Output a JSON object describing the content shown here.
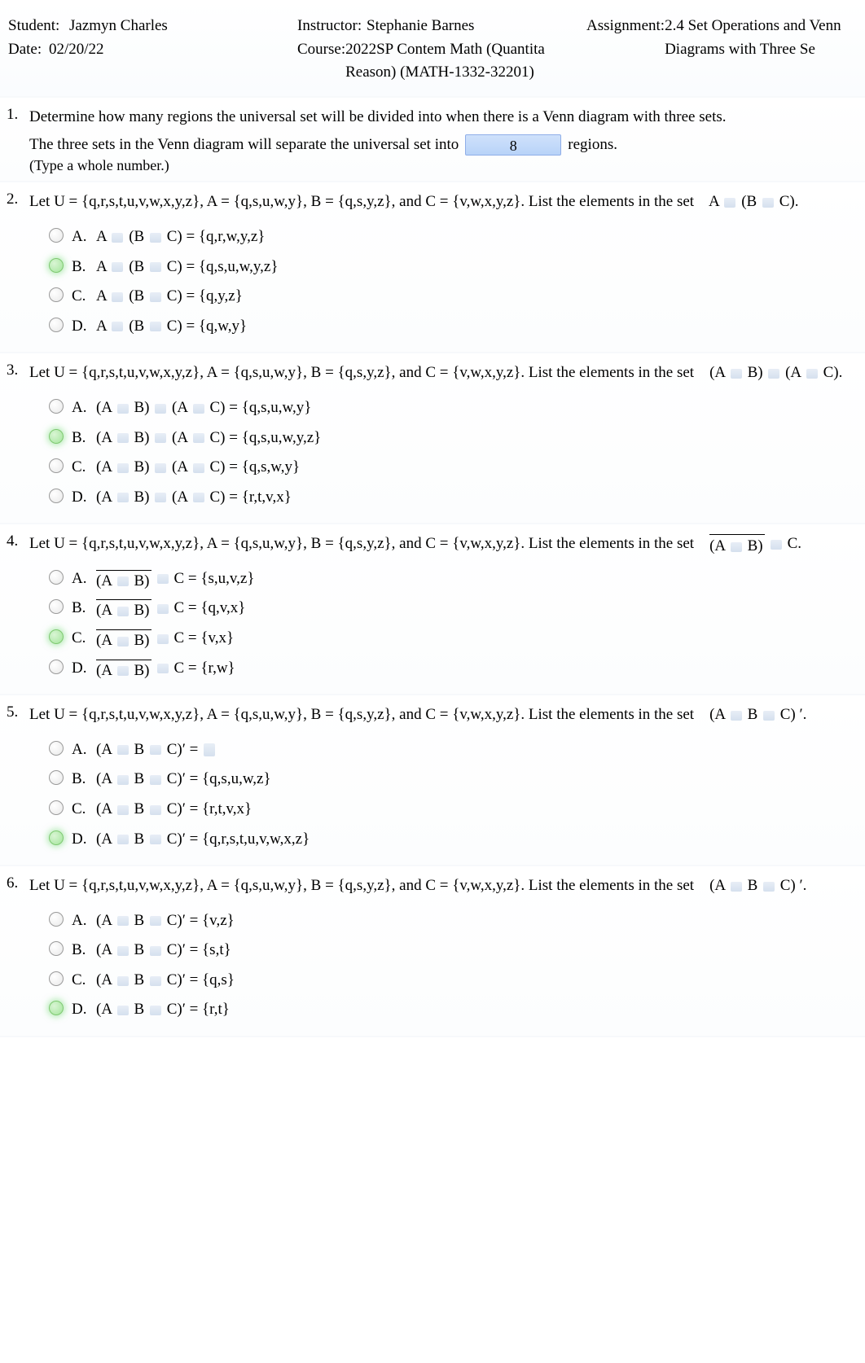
{
  "header": {
    "student_label": "Student:",
    "student": "Jazmyn Charles",
    "date_label": "Date:",
    "date": "02/20/22",
    "instructor_label": "Instructor:",
    "instructor": "Stephanie Barnes",
    "course_label": "Course:",
    "course": "2022SP Contem Math (Quantita Reason) (MATH-1332-32201)",
    "assignment_label": "Assignment:",
    "assignment": "2.4 Set Operations and Venn Diagrams with Three Se"
  },
  "q1": {
    "num": "1.",
    "prompt": "Determine how many regions the universal set will be divided into when there is a Venn diagram with three sets.",
    "line_before": "The three sets in the Venn diagram will separate the universal set into",
    "answer": "8",
    "line_after": "regions.",
    "hint": "(Type a whole number.)"
  },
  "q2": {
    "num": "2.",
    "prompt_part1": "Let U",
    "setU": "= {q,r,s,t,u,v,w,x,y,z}, A",
    "setA": "= {q,s,u,w,y}, B",
    "setB": "= {q,s,y,z}, and C",
    "setC": "= {v,w,x,y,z}. List the elements in the set",
    "tail1": "A",
    "tail2": "(B",
    "tail3": "C).",
    "choices": [
      {
        "letter": "A.",
        "expr_lhs": "A",
        "expr_mid": "(B",
        "expr_end": "C) =",
        "rhs": "{q,r,w,y,z}",
        "correct": false
      },
      {
        "letter": "B.",
        "expr_lhs": "A",
        "expr_mid": "(B",
        "expr_end": "C) =",
        "rhs": "{q,s,u,w,y,z}",
        "correct": true
      },
      {
        "letter": "C.",
        "expr_lhs": "A",
        "expr_mid": "(B",
        "expr_end": "C) =",
        "rhs": "{q,y,z}",
        "correct": false
      },
      {
        "letter": "D.",
        "expr_lhs": "A",
        "expr_mid": "(B",
        "expr_end": "C) =",
        "rhs": "{q,w,y}",
        "correct": false
      }
    ]
  },
  "q3": {
    "num": "3.",
    "prompt_part1": "Let U",
    "setU": "= {q,r,s,t,u,v,w,x,y,z}, A",
    "setA": "= {q,s,u,w,y}, B",
    "setB": "= {q,s,y,z}, and C",
    "setC": "= {v,w,x,y,z}. List the elements in the set",
    "tail_ab": "(A",
    "tail_b": "B)",
    "tail_ac": "(A",
    "tail_c": "C).",
    "choices": [
      {
        "letter": "A.",
        "l1": "(A",
        "l2": "B)",
        "l3": "(A",
        "l4": "C) =",
        "rhs": "{q,s,u,w,y}",
        "correct": false
      },
      {
        "letter": "B.",
        "l1": "(A",
        "l2": "B)",
        "l3": "(A",
        "l4": "C) =",
        "rhs": "{q,s,u,w,y,z}",
        "correct": true
      },
      {
        "letter": "C.",
        "l1": "(A",
        "l2": "B)",
        "l3": "(A",
        "l4": "C) =",
        "rhs": "{q,s,w,y}",
        "correct": false
      },
      {
        "letter": "D.",
        "l1": "(A",
        "l2": "B)",
        "l3": "(A",
        "l4": "C) =",
        "rhs": "{r,t,v,x}",
        "correct": false
      }
    ]
  },
  "q4": {
    "num": "4.",
    "prompt_part1": "Let U",
    "setU": "= {q,r,s,t,u,v,w,x,y,z}, A",
    "setA": "= {q,s,u,w,y}, B",
    "setB": "= {q,s,y,z}, and C",
    "setC": "= {v,w,x,y,z}. List the elements in the set",
    "tail_ab": "(A",
    "tail_b": "B)",
    "tail_c": "C.",
    "choices": [
      {
        "letter": "A.",
        "l1": "(A",
        "l2": "B)",
        "l3": "C =",
        "rhs": "{s,u,v,z}",
        "correct": false
      },
      {
        "letter": "B.",
        "l1": "(A",
        "l2": "B)",
        "l3": "C =",
        "rhs": "{q,v,x}",
        "correct": false
      },
      {
        "letter": "C.",
        "l1": "(A",
        "l2": "B)",
        "l3": "C =",
        "rhs": "{v,x}",
        "correct": true
      },
      {
        "letter": "D.",
        "l1": "(A",
        "l2": "B)",
        "l3": "C =",
        "rhs": "{r,w}",
        "correct": false
      }
    ]
  },
  "q5": {
    "num": "5.",
    "prompt_part1": "Let U",
    "setU": "= {q,r,s,t,u,v,w,x,y,z}, A",
    "setA": "= {q,s,u,w,y}, B",
    "setB": "= {q,s,y,z}, and C",
    "setC": "= {v,w,x,y,z}. List the elements in the set",
    "tail_a": "(A",
    "tail_b": "B",
    "tail_c": "C)",
    "prime": "′.",
    "choices": [
      {
        "letter": "A.",
        "l1": "(A",
        "l2": "B",
        "l3": "C)",
        "prime": "′ =",
        "rhs": "",
        "correct": false,
        "empty": true
      },
      {
        "letter": "B.",
        "l1": "(A",
        "l2": "B",
        "l3": "C)",
        "prime": "′ =",
        "rhs": "{q,s,u,w,z}",
        "correct": false
      },
      {
        "letter": "C.",
        "l1": "(A",
        "l2": "B",
        "l3": "C)",
        "prime": "′ =",
        "rhs": "{r,t,v,x}",
        "correct": false
      },
      {
        "letter": "D.",
        "l1": "(A",
        "l2": "B",
        "l3": "C)",
        "prime": "′ =",
        "rhs": "{q,r,s,t,u,v,w,x,z}",
        "correct": true
      }
    ]
  },
  "q6": {
    "num": "6.",
    "prompt_part1": "Let U",
    "setU": "= {q,r,s,t,u,v,w,x,y,z}, A",
    "setA": "= {q,s,u,w,y}, B",
    "setB": "= {q,s,y,z}, and C",
    "setC": "= {v,w,x,y,z}. List the elements in the set",
    "tail_a": "(A",
    "tail_b": "B",
    "tail_c": "C)",
    "prime": "′.",
    "choices": [
      {
        "letter": "A.",
        "l1": "(A",
        "l2": "B",
        "l3": "C)",
        "prime": "′ =",
        "rhs": "{v,z}",
        "correct": false
      },
      {
        "letter": "B.",
        "l1": "(A",
        "l2": "B",
        "l3": "C)",
        "prime": "′ =",
        "rhs": "{s,t}",
        "correct": false
      },
      {
        "letter": "C.",
        "l1": "(A",
        "l2": "B",
        "l3": "C)",
        "prime": "′ =",
        "rhs": "{q,s}",
        "correct": false
      },
      {
        "letter": "D.",
        "l1": "(A",
        "l2": "B",
        "l3": "C)",
        "prime": "′ =",
        "rhs": "{r,t}",
        "correct": true
      }
    ]
  }
}
